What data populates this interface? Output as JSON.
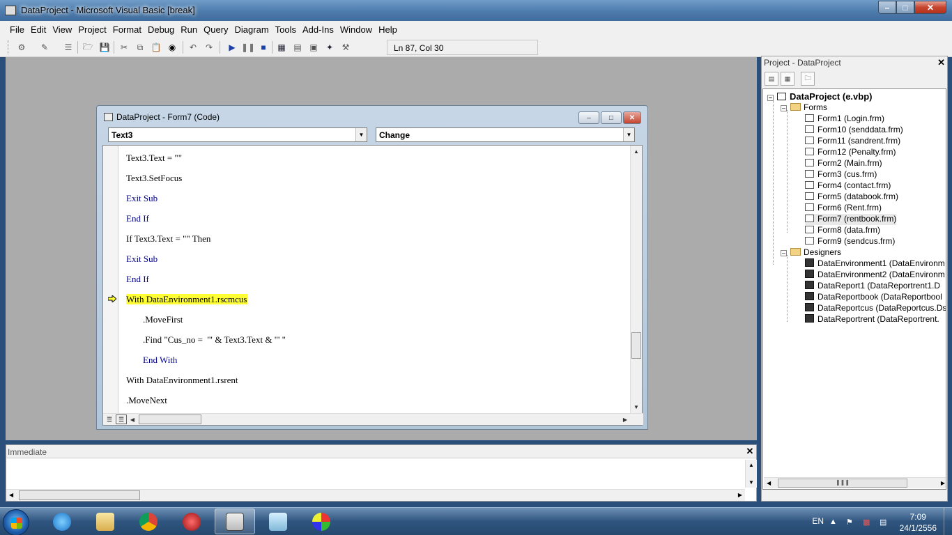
{
  "window": {
    "title": "DataProject - Microsoft Visual Basic [break]"
  },
  "menu": [
    "File",
    "Edit",
    "View",
    "Project",
    "Format",
    "Debug",
    "Run",
    "Query",
    "Diagram",
    "Tools",
    "Add-Ins",
    "Window",
    "Help"
  ],
  "toolbar": {
    "position": "Ln 87, Col 30"
  },
  "code_window": {
    "title": "DataProject - Form7 (Code)",
    "object_combo": "Text3",
    "proc_combo": "Change",
    "lines": [
      {
        "text": "Text3.Text = \"\"",
        "indent": 0
      },
      {
        "text": "Text3.SetFocus",
        "indent": 0
      },
      {
        "text": "Exit Sub",
        "indent": 0,
        "kw": true
      },
      {
        "text": "End If",
        "indent": 0,
        "kw": true
      },
      {
        "text": "If Text3.Text = \"\" Then",
        "indent": 0
      },
      {
        "text": "Exit Sub",
        "indent": 0,
        "kw": true
      },
      {
        "text": "End If",
        "indent": 0,
        "kw": true
      },
      {
        "text": "With DataEnvironment1.rscmcus",
        "indent": 0,
        "highlight": true
      },
      {
        "text": ".MoveFirst",
        "indent": 1
      },
      {
        "text": ".Find \"Cus_no =  '\" & Text3.Text & \"' \"",
        "indent": 1
      },
      {
        "text": "End With",
        "indent": 1,
        "kw": true
      },
      {
        "text": "With DataEnvironment1.rsrent",
        "indent": 0
      },
      {
        "text": ".MoveNext",
        "indent": 0
      }
    ]
  },
  "immediate": {
    "title": "Immediate"
  },
  "project": {
    "title": "Project - DataProject",
    "root": "DataProject (e.vbp)",
    "forms_label": "Forms",
    "forms": [
      "Form1 (Login.frm)",
      "Form10 (senddata.frm)",
      "Form11 (sandrent.frm)",
      "Form12 (Penalty.frm)",
      "Form2 (Main.frm)",
      "Form3 (cus.frm)",
      "Form4 (contact.frm)",
      "Form5 (databook.frm)",
      "Form6 (Rent.frm)",
      "Form7 (rentbook.frm)",
      "Form8 (data.frm)",
      "Form9 (sendcus.frm)"
    ],
    "designers_label": "Designers",
    "designers": [
      "DataEnvironment1 (DataEnvironm",
      "DataEnvironment2 (DataEnvironm",
      "DataReport1 (DataReportrent1.D",
      "DataReportbook (DataReportbool",
      "DataReportcus (DataReportcus.Ds",
      "DataReportrent (DataReportrent."
    ]
  },
  "taskbar": {
    "lang": "EN",
    "time": "7:09",
    "date": "24/1/2556"
  },
  "colors": {
    "highlight": "#ffff33",
    "keyword": "#00008b"
  }
}
